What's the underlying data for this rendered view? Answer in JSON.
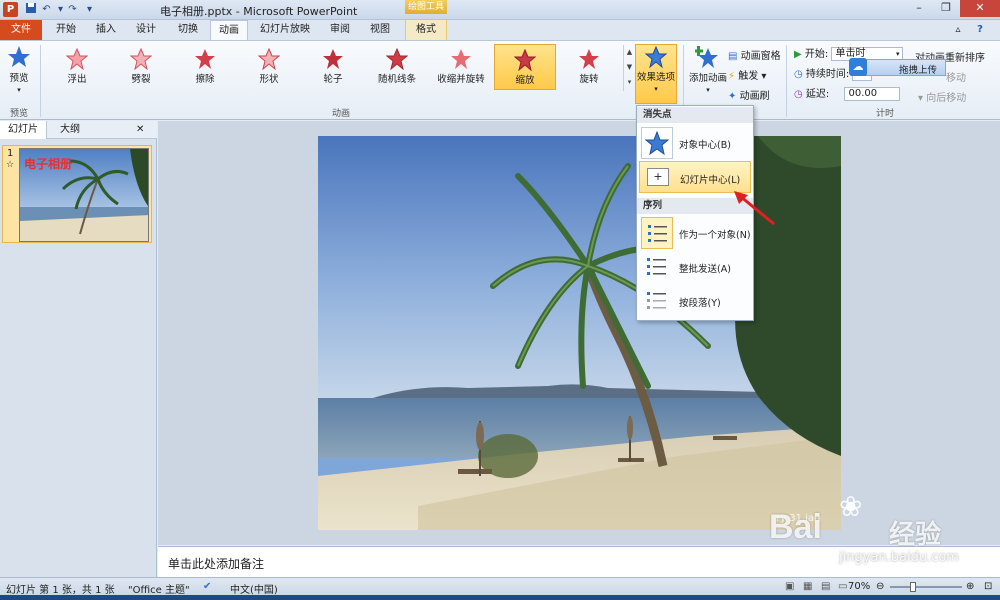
{
  "window": {
    "title": "电子相册.pptx - Microsoft PowerPoint",
    "contextual_tab_group": "绘图工具",
    "app_icon_letter": "P"
  },
  "tabs": [
    "文件",
    "开始",
    "插入",
    "设计",
    "切换",
    "动画",
    "幻灯片放映",
    "审阅",
    "视图",
    "格式"
  ],
  "ribbon": {
    "preview_label": "预览",
    "preview_group": "预览",
    "animations_group": "动画",
    "timing_group": "计时",
    "animations": [
      "浮出",
      "劈裂",
      "擦除",
      "形状",
      "轮子",
      "随机线条",
      "收缩并旋转",
      "缩放",
      "旋转"
    ],
    "selected_animation": "缩放",
    "effect_options": "效果选项",
    "add_animation": "添加动画",
    "animation_pane": "动画窗格",
    "trigger": "触发",
    "animation_painter": "动画刷",
    "start_label": "开始:",
    "start_value": "单击时",
    "duration_label": "持续时间:",
    "duration_value": "00",
    "delay_label": "延迟:",
    "delay_value": "00.00",
    "reorder_label": "对动画重新排序",
    "move_earlier": "移动",
    "move_later": "向后移动"
  },
  "upload_tip": "拖拽上传",
  "left_pane": {
    "tab_slides": "幻灯片",
    "tab_outline": "大纲",
    "slide_number": "1",
    "thumb_title": "电子相册"
  },
  "dropdown": {
    "section_vanish": "消失点",
    "item_object_center": "对象中心(B)",
    "item_slide_center": "幻灯片中心(L)",
    "section_sequence": "序列",
    "item_as_one": "作为一个对象(N)",
    "item_all_at_once": "整批发送(A)",
    "item_by_paragraph": "按段落(Y)"
  },
  "notes_placeholder": "单击此处添加备注",
  "status": {
    "slide_info": "幻灯片 第 1 张，共 1 张",
    "theme": "\"Office 主题\"",
    "language": "中文(中国)",
    "zoom": "70%"
  },
  "watermark": {
    "brand": "Bai",
    "brand_suffix": "经验",
    "url": "jingyan.baidu.com"
  },
  "colors": {
    "file_tab": "#d64b1d",
    "selected_animation": "#ffc94a",
    "contextual_tab": "#e4ad2d"
  }
}
